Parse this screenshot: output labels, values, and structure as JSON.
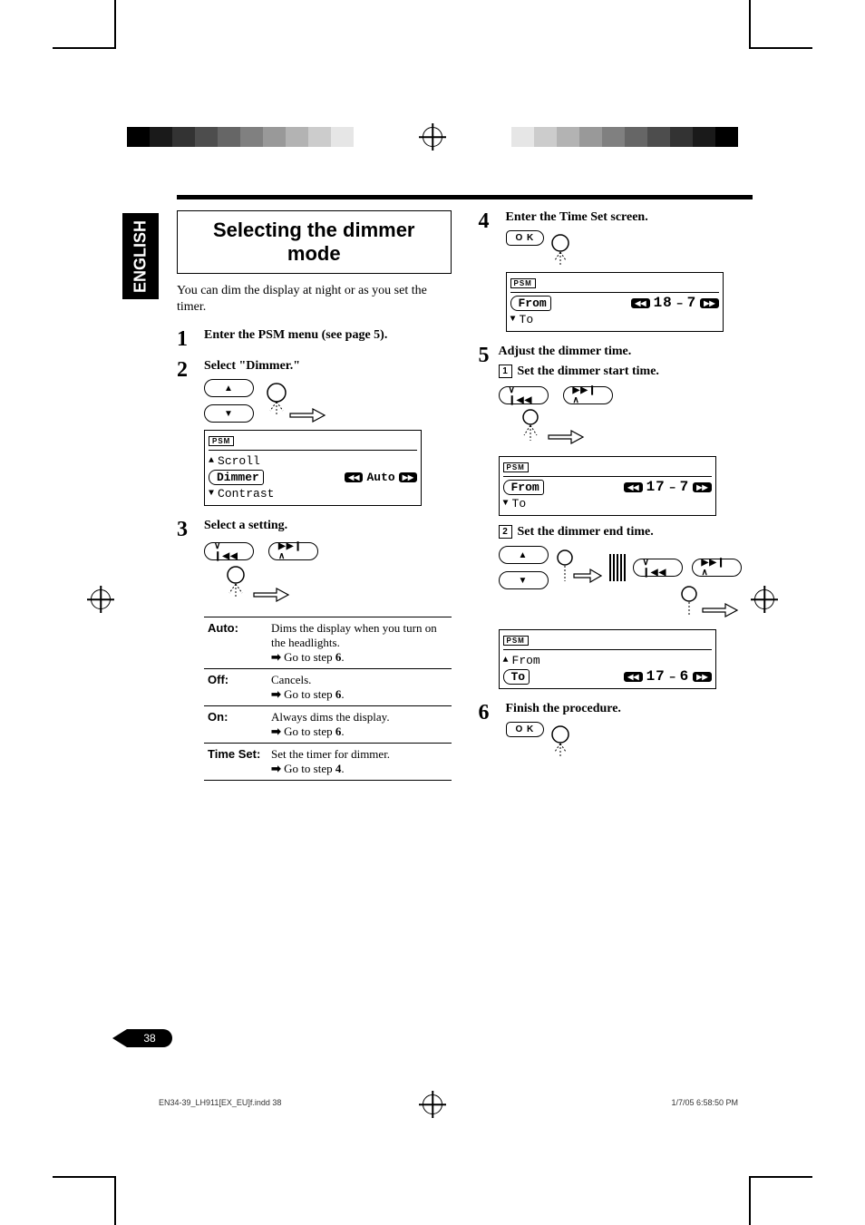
{
  "page_number": "38",
  "language_tab": "ENGLISH",
  "section_title": "Selecting the dimmer mode",
  "intro_text": "You can dim the display at night or as you set the timer.",
  "steps": {
    "s1": "Enter the PSM menu (see page 5).",
    "s2": "Select \"Dimmer.\"",
    "s3": "Select a setting.",
    "s4": "Enter the Time Set screen.",
    "s5": "Adjust the dimmer time.",
    "s5a": "Set the dimmer start time.",
    "s5b": "Set the dimmer end time.",
    "s6": "Finish the procedure."
  },
  "lcd": {
    "psm": "PSM",
    "scroll": "Scroll",
    "dimmer": "Dimmer",
    "contrast": "Contrast",
    "auto": "Auto",
    "from": "From",
    "to": "To",
    "v18": "18",
    "v7": "7",
    "v17": "17",
    "v6": "6"
  },
  "settings": [
    {
      "name": "Auto",
      "desc": "Dims the display when you turn on the headlights.",
      "goto_prefix": "Go to step",
      "goto_num": "6"
    },
    {
      "name": "Off",
      "desc": "Cancels.",
      "goto_prefix": "Go to step",
      "goto_num": "6"
    },
    {
      "name": "On",
      "desc": "Always dims the display.",
      "goto_prefix": "Go to step",
      "goto_num": "6"
    },
    {
      "name": "Time Set",
      "desc": "Set the timer for dimmer.",
      "goto_prefix": "Go to step",
      "goto_num": "4"
    }
  ],
  "buttons": {
    "ok": "O K",
    "up": "▲",
    "down": "▼",
    "prev": "∨ ❙◀◀",
    "next": "▶▶❙ ∧"
  },
  "footer": {
    "file": "EN34-39_LH911[EX_EU]f.indd   38",
    "date": "1/7/05   6:58:50 PM"
  }
}
